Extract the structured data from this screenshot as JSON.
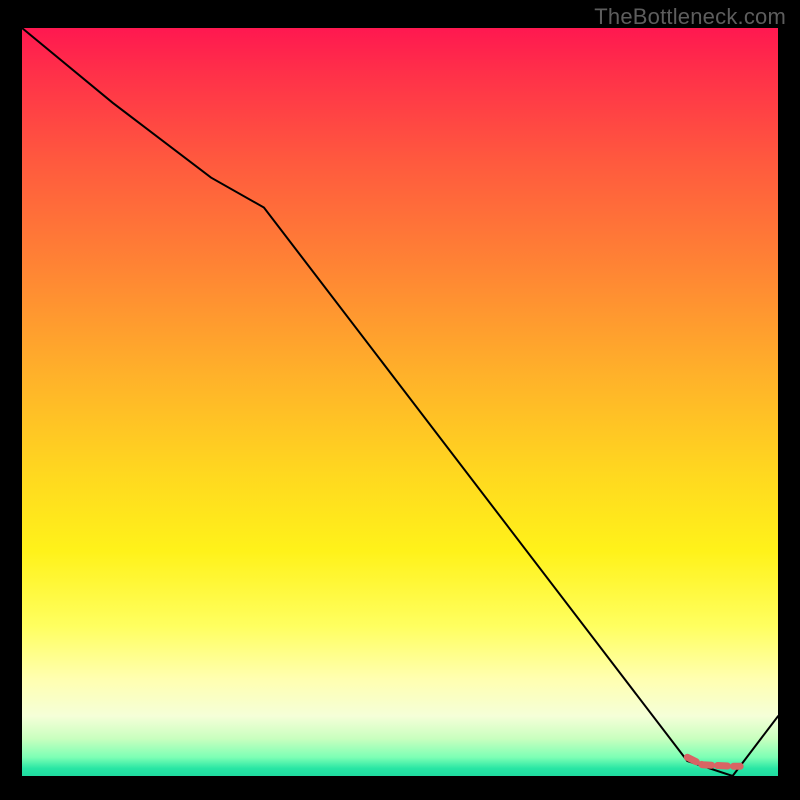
{
  "watermark": "TheBottleneck.com",
  "chart_data": {
    "type": "line",
    "title": "",
    "xlabel": "",
    "ylabel": "",
    "xlim": [
      0,
      100
    ],
    "ylim": [
      0,
      100
    ],
    "series": [
      {
        "name": "main-curve",
        "x": [
          0,
          12,
          25,
          32,
          88,
          94,
          100
        ],
        "values": [
          100,
          90,
          80,
          76,
          2,
          0,
          8
        ]
      },
      {
        "name": "accent-segment",
        "x": [
          88,
          90,
          94,
          95
        ],
        "values": [
          2.5,
          1.5,
          1.3,
          1.3
        ]
      }
    ],
    "gradient_stops": [
      {
        "pos": 0,
        "color": "#ff1850"
      },
      {
        "pos": 0.32,
        "color": "#ff8434"
      },
      {
        "pos": 0.6,
        "color": "#ffd91f"
      },
      {
        "pos": 0.87,
        "color": "#ffffb0"
      },
      {
        "pos": 1.0,
        "color": "#1fdba0"
      }
    ]
  }
}
